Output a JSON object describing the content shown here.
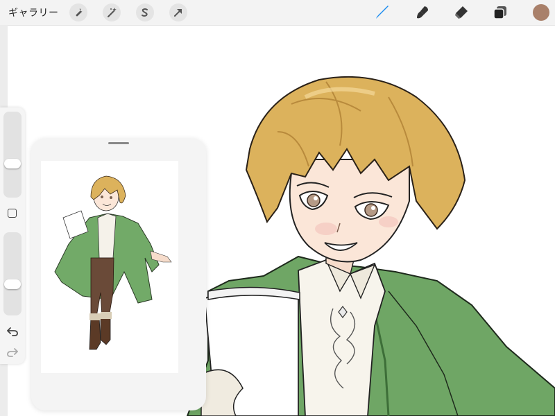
{
  "topbar": {
    "gallery_label": "ギャラリー",
    "left_tools": [
      {
        "name": "actions",
        "icon": "wrench-icon"
      },
      {
        "name": "adjustments",
        "icon": "magic-wand-icon"
      },
      {
        "name": "selection",
        "icon": "selection-s-icon"
      },
      {
        "name": "transform",
        "icon": "arrow-cursor-icon"
      }
    ],
    "right_tools": [
      {
        "name": "brush",
        "icon": "brush-icon",
        "active": true
      },
      {
        "name": "smudge",
        "icon": "smudge-icon"
      },
      {
        "name": "eraser",
        "icon": "eraser-icon"
      },
      {
        "name": "layers",
        "icon": "layers-icon"
      }
    ],
    "current_color": "#a9806a",
    "active_tool_color": "#1a8cf0"
  },
  "sidebar": {
    "brush_size_level": 0.38,
    "opacity_level": 0.35,
    "buttons": [
      "modify-icon",
      "undo-icon",
      "redo-icon"
    ]
  },
  "reference_panel": {
    "content": "character-artwork-thumbnail"
  },
  "canvas": {
    "content": "character-artwork-closeup"
  }
}
